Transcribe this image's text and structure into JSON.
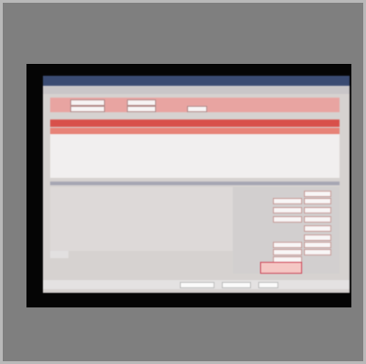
{
  "photo": {
    "subject": "",
    "total_value": "",
    "menu_items": []
  }
}
